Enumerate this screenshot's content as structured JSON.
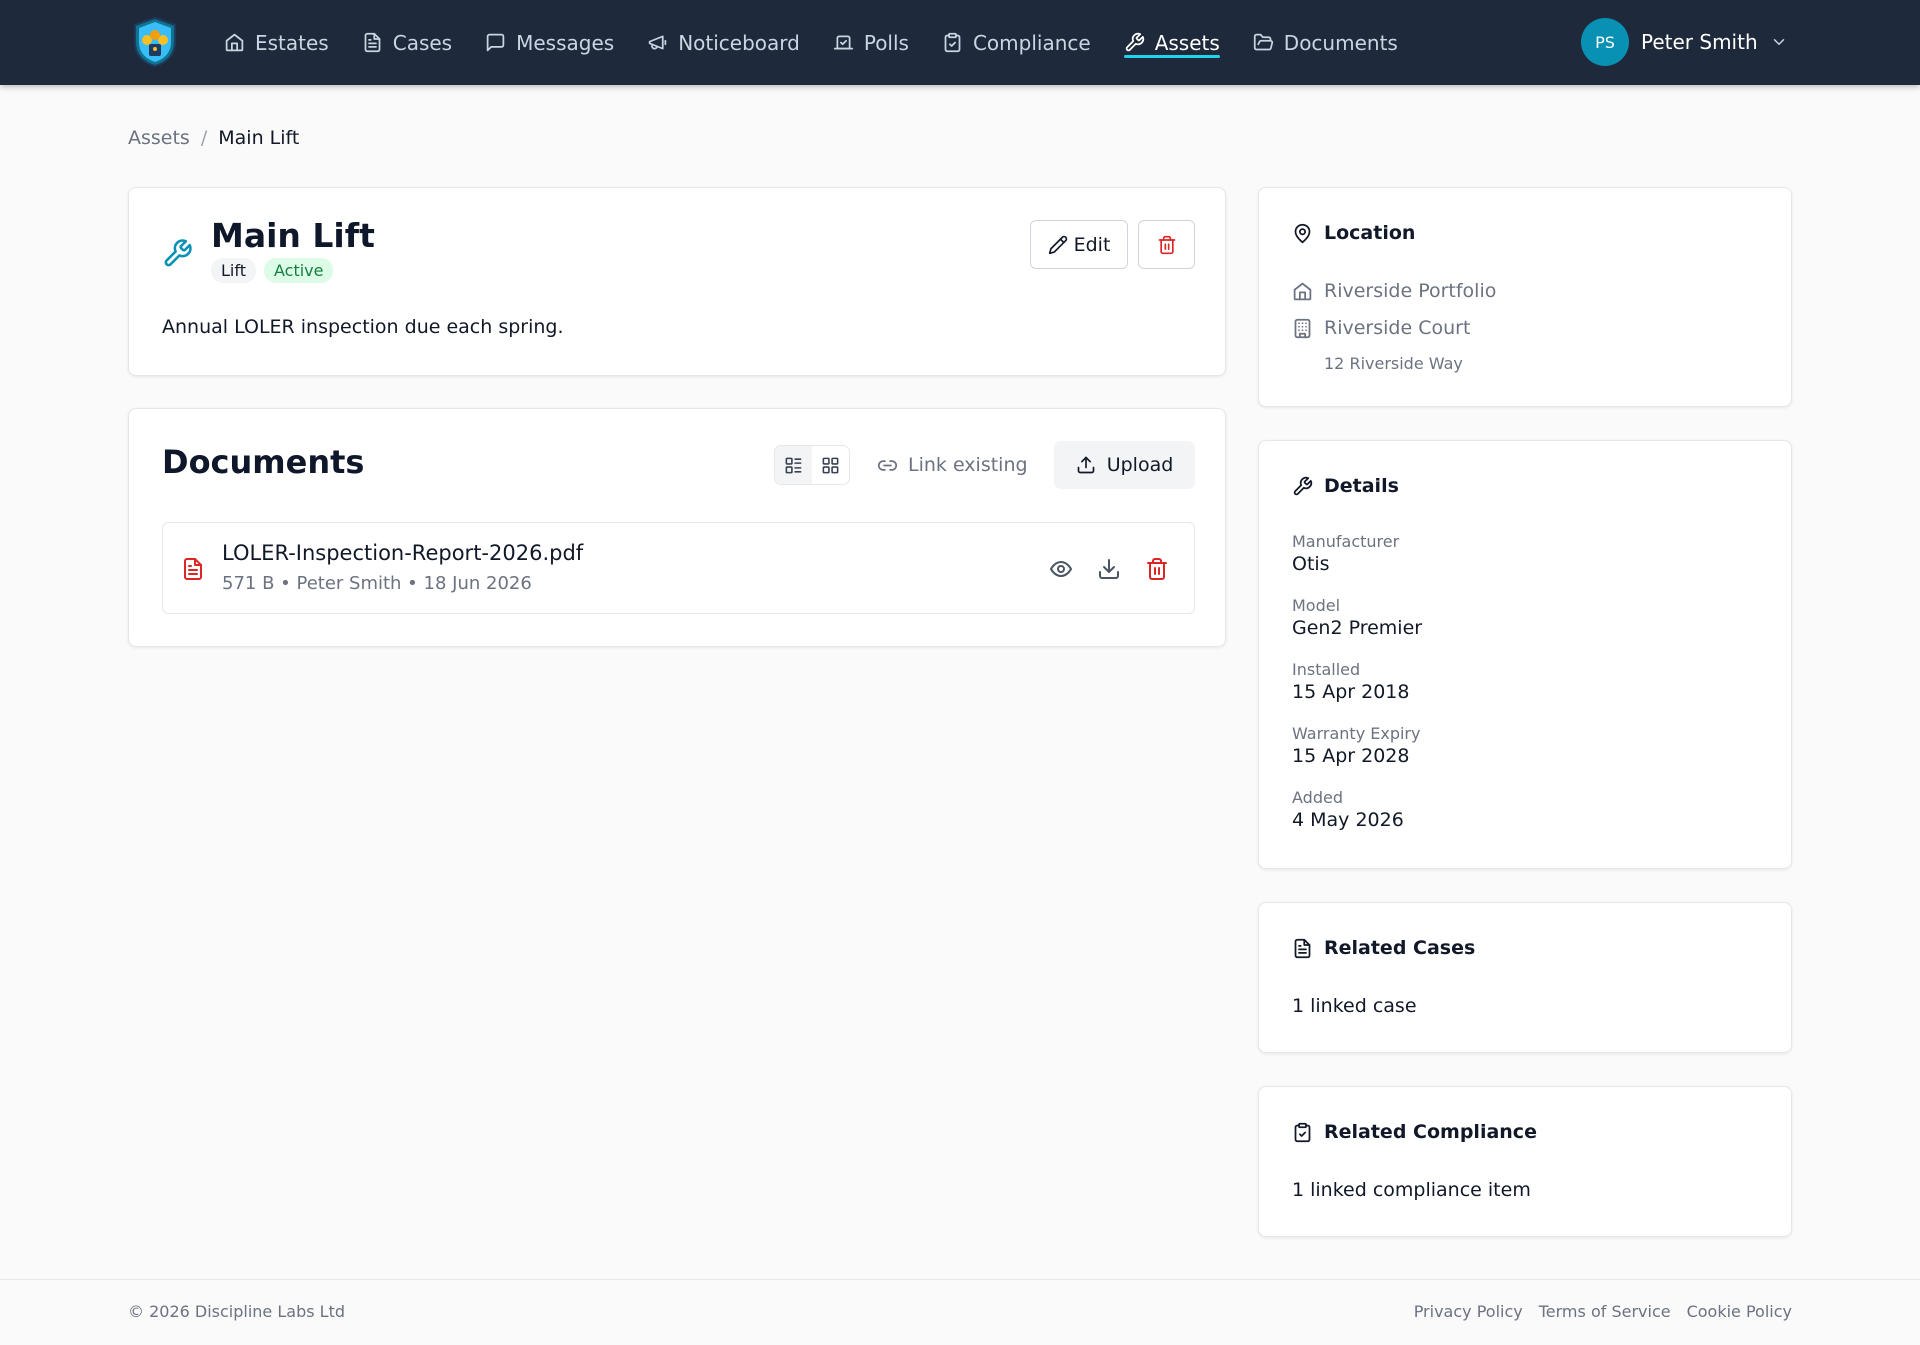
{
  "colors": {
    "nav_bg": "#1e293b",
    "accent": "#0891b2",
    "active_underline": "#22d3ee",
    "danger": "#dc2626",
    "success_bg": "#dcfce7",
    "success_text": "#15803d"
  },
  "nav": {
    "logo_icon": "shield-logo-icon",
    "items": [
      {
        "label": "Estates",
        "icon": "home-icon"
      },
      {
        "label": "Cases",
        "icon": "file-text-icon"
      },
      {
        "label": "Messages",
        "icon": "message-square-icon"
      },
      {
        "label": "Noticeboard",
        "icon": "megaphone-icon"
      },
      {
        "label": "Polls",
        "icon": "vote-icon"
      },
      {
        "label": "Compliance",
        "icon": "clipboard-check-icon"
      },
      {
        "label": "Assets",
        "icon": "wrench-icon",
        "active": true
      },
      {
        "label": "Documents",
        "icon": "folder-open-icon"
      }
    ],
    "user": {
      "initials": "PS",
      "name": "Peter Smith"
    }
  },
  "breadcrumb": {
    "parent": "Assets",
    "separator": "/",
    "current": "Main Lift"
  },
  "asset": {
    "title": "Main Lift",
    "type_tag": "Lift",
    "status_tag": "Active",
    "description": "Annual LOLER inspection due each spring.",
    "edit_label": "Edit"
  },
  "documents": {
    "heading": "Documents",
    "link_existing_label": "Link existing",
    "upload_label": "Upload",
    "files": [
      {
        "name": "LOLER-Inspection-Report-2026.pdf",
        "meta": "571 B • Peter Smith • 18 Jun 2026"
      }
    ]
  },
  "location": {
    "heading": "Location",
    "portfolio": "Riverside Portfolio",
    "building": "Riverside Court",
    "address": "12 Riverside Way"
  },
  "details": {
    "heading": "Details",
    "fields": [
      {
        "label": "Manufacturer",
        "value": "Otis"
      },
      {
        "label": "Model",
        "value": "Gen2 Premier"
      },
      {
        "label": "Installed",
        "value": "15 Apr 2018"
      },
      {
        "label": "Warranty Expiry",
        "value": "15 Apr 2028"
      },
      {
        "label": "Added",
        "value": "4 May 2026"
      }
    ]
  },
  "related_cases": {
    "heading": "Related Cases",
    "summary": "1 linked case"
  },
  "related_compliance": {
    "heading": "Related Compliance",
    "summary": "1 linked compliance item"
  },
  "footer": {
    "copyright": "© 2026 Discipline Labs Ltd",
    "links": [
      "Privacy Policy",
      "Terms of Service",
      "Cookie Policy"
    ]
  }
}
